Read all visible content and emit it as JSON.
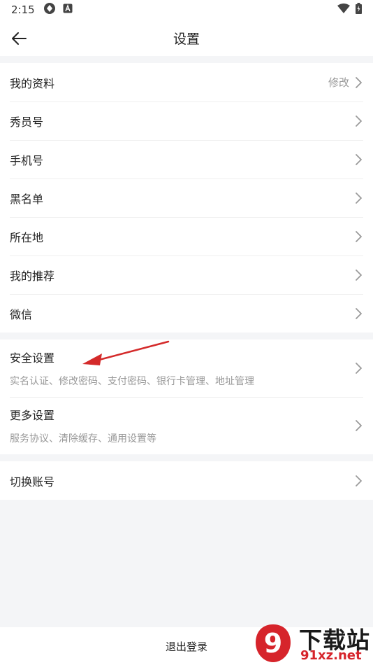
{
  "status_bar": {
    "time": "2:15"
  },
  "header": {
    "title": "设置"
  },
  "groups": [
    {
      "items": [
        {
          "label": "我的资料",
          "value": "修改"
        },
        {
          "label": "秀员号"
        },
        {
          "label": "手机号"
        },
        {
          "label": "黑名单"
        },
        {
          "label": "所在地"
        },
        {
          "label": "我的推荐"
        },
        {
          "label": "微信"
        }
      ]
    },
    {
      "items": [
        {
          "label": "安全设置",
          "sub": "实名认证、修改密码、支付密码、银行卡管理、地址管理"
        },
        {
          "label": "更多设置",
          "sub": "服务协议、清除缓存、通用设置等"
        }
      ]
    },
    {
      "items": [
        {
          "label": "切换账号"
        }
      ]
    }
  ],
  "logout": {
    "label": "退出登录"
  },
  "watermark": {
    "big": "下载站",
    "small": "91xz.net",
    "badge": "9"
  },
  "icons": {
    "back": "arrow-left-icon",
    "chevron": "chevron-right-icon",
    "wifi": "wifi-icon",
    "battery": "battery-icon"
  },
  "colors": {
    "annotation_arrow": "#d42a2a",
    "watermark_red": "#d6242b"
  }
}
